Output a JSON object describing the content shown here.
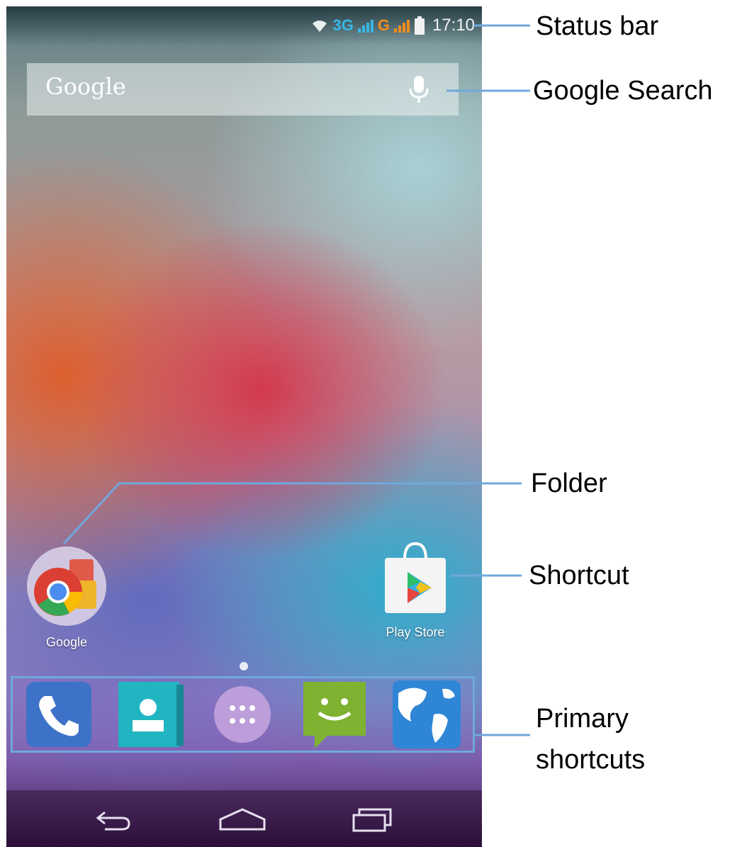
{
  "status_bar": {
    "network_3g": "3G",
    "network_g": "G",
    "time": "17:10"
  },
  "search": {
    "logo_text": "Google"
  },
  "apps": {
    "folder_label": "Google",
    "store_label": "Play Store"
  },
  "dock": {
    "items": [
      "phone-icon",
      "contacts-icon",
      "app-drawer-icon",
      "messaging-icon",
      "browser-icon"
    ]
  },
  "callouts": {
    "status_bar": "Status bar",
    "google_search": "Google Search",
    "folder": "Folder",
    "shortcut": "Shortcut",
    "primary_shortcuts_line1": "Primary",
    "primary_shortcuts_line2": "shortcuts"
  },
  "colors": {
    "callout_line": "#6fa8dc",
    "network_3g": "#39b7e6",
    "network_g": "#f08c1e"
  }
}
